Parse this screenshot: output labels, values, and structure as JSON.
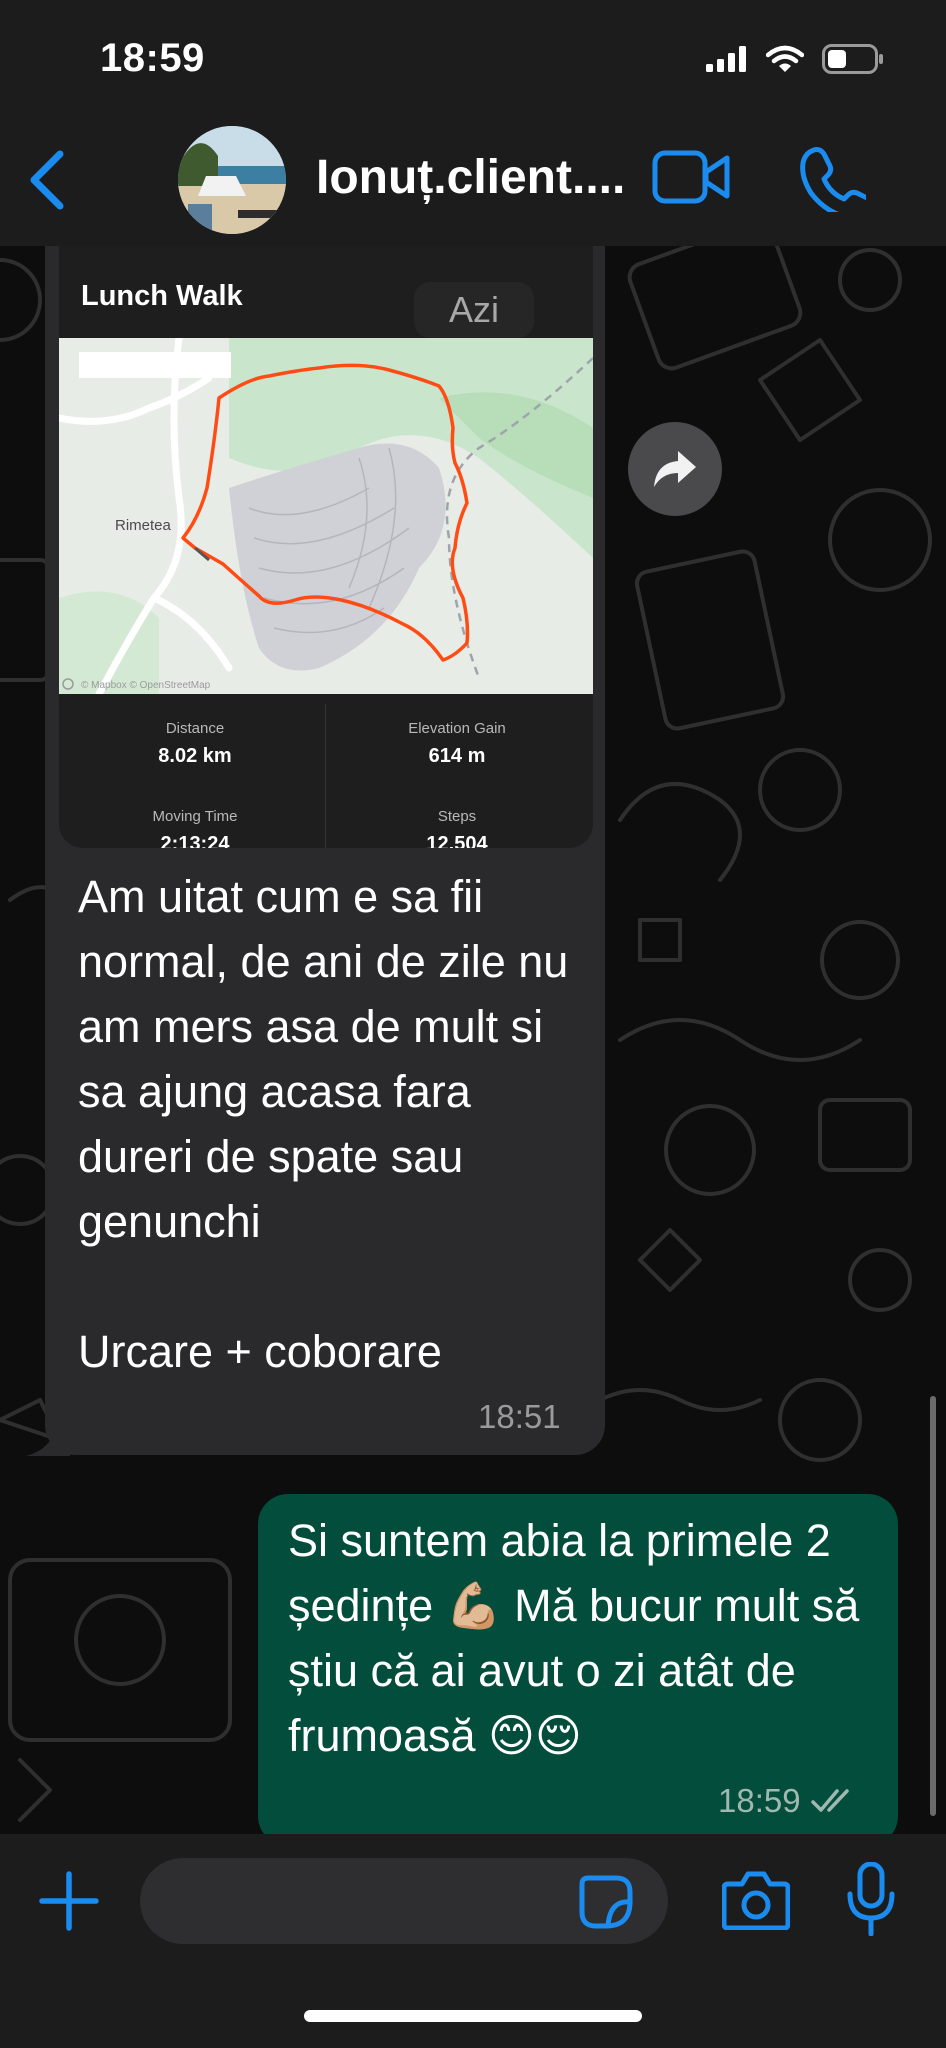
{
  "status_bar": {
    "time": "18:59"
  },
  "header": {
    "contact_name": "Ionuț.client...."
  },
  "strava_card": {
    "title": "Lunch Walk",
    "map_place_label": "Rimetea",
    "map_credit": "© Mapbox © OpenStreetMap",
    "stats": [
      {
        "label": "Distance",
        "value": "8.02 km"
      },
      {
        "label": "Elevation Gain",
        "value": "614 m"
      },
      {
        "label": "Moving Time",
        "value": "2:13:24"
      },
      {
        "label": "Steps",
        "value": "12,504"
      }
    ]
  },
  "date_separator": "Azi",
  "incoming_message": {
    "text": "Am uitat cum e sa fii normal, de ani de zile nu am mers asa de mult si sa ajung acasa fara dureri de spate sau genunchi\n\nUrcare + coborare",
    "time": "18:51"
  },
  "outgoing_message": {
    "text": "Si suntem abia la primele 2 ședințe 💪🏼 Mă bucur mult să știu că ai avut o zi atât de frumoasă 😊😌",
    "time": "18:59",
    "status": "read"
  },
  "input": {
    "placeholder": ""
  },
  "colors": {
    "accent": "#1a8cf0",
    "outgoing_bubble": "#024d3b",
    "incoming_bubble": "#2a2a2c",
    "route": "#ff4b14"
  },
  "icons": {
    "back": "chevron-left-icon",
    "video": "video-camera-icon",
    "call": "phone-icon",
    "forward": "forward-arrow-icon",
    "plus": "plus-icon",
    "sticker": "sticker-icon",
    "camera": "camera-icon",
    "mic": "microphone-icon"
  }
}
